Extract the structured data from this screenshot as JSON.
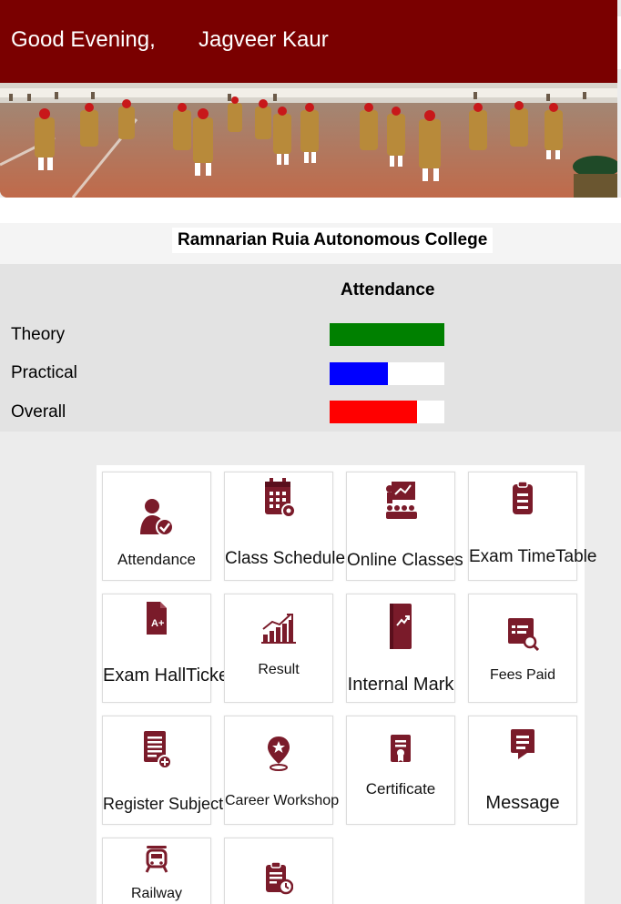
{
  "header": {
    "greeting": "Good Evening,",
    "user_name": "Jagveer Kaur"
  },
  "college": {
    "name": "Ramnarian Ruia Autonomous College"
  },
  "attendance": {
    "title": "Attendance",
    "rows": [
      {
        "label": "Theory",
        "fill_fraction": 1.0,
        "color": "#008000"
      },
      {
        "label": "Practical",
        "fill_fraction": 0.51,
        "color": "#0000ff"
      },
      {
        "label": "Overall",
        "fill_fraction": 0.76,
        "color": "#ff0000"
      }
    ]
  },
  "menu": {
    "icon_color": "#7a1b2a",
    "tiles": [
      {
        "label": "Attendance",
        "icon": "user-check-icon"
      },
      {
        "label": "Class Schedule",
        "icon": "calendar-icon"
      },
      {
        "label": "Online Classes",
        "icon": "classroom-icon"
      },
      {
        "label": "Exam TimeTable",
        "icon": "clipboard-icon"
      },
      {
        "label": "Exam HallTicket",
        "icon": "grade-document-icon"
      },
      {
        "label": "Result",
        "icon": "growth-chart-icon"
      },
      {
        "label": "Internal Mark",
        "icon": "trend-book-icon"
      },
      {
        "label": "Fees Paid",
        "icon": "receipt-search-icon"
      },
      {
        "label": "Register Subject",
        "icon": "register-document-icon"
      },
      {
        "label": "Career Workshop",
        "icon": "location-star-icon"
      },
      {
        "label": "Certificate",
        "icon": "certificate-icon"
      },
      {
        "label": "Message",
        "icon": "message-icon"
      },
      {
        "label": "Railway",
        "icon": "train-icon"
      },
      {
        "label": "",
        "icon": "clipboard-clock-icon"
      }
    ]
  },
  "colors": {
    "header_bg": "#7a0000",
    "panel_bg": "#e3e3e3",
    "page_bg": "#ececec"
  }
}
